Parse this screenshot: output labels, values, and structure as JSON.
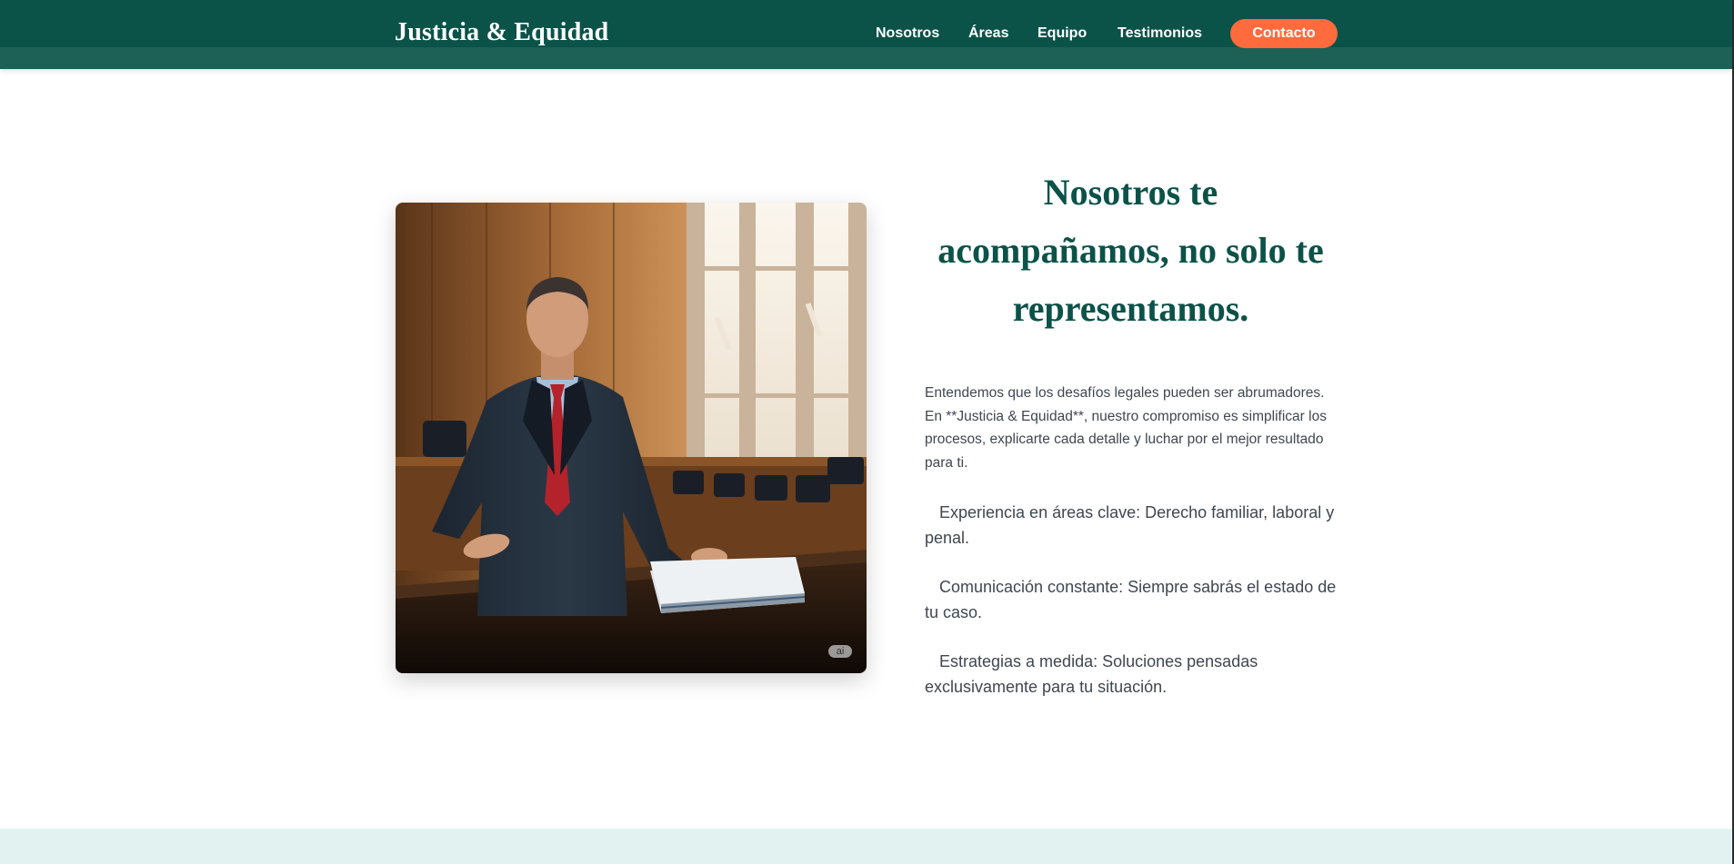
{
  "brand": {
    "name": "Justicia & Equidad"
  },
  "nav": {
    "items": [
      "Nosotros",
      "Áreas",
      "Equipo",
      "Testimonios"
    ],
    "cta_label": "Contacto"
  },
  "hero": {
    "image_badge": "ai",
    "heading_lines": [
      "Nosotros te",
      "acompañamos, no solo te",
      "representamos."
    ],
    "intro": "Entendemos que los desafíos legales pueden ser abrumadores. En **Justicia & Equidad**, nuestro compromiso es simplificar los procesos, explicarte cada detalle y luchar por el mejor resultado para ti.",
    "features": [
      "Experiencia en áreas clave: Derecho familiar, laboral y penal.",
      "Comunicación constante: Siempre sabrás el estado de tu caso.",
      "Estrategias a medida: Soluciones pensadas exclusivamente para tu situación."
    ]
  },
  "colors": {
    "header_bg": "#0b5248",
    "header_band": "#1d6156",
    "accent": "#ff6b3d",
    "heading": "#0b5248",
    "body_text": "#3f4750",
    "section_bg": "#e1f2f1"
  }
}
